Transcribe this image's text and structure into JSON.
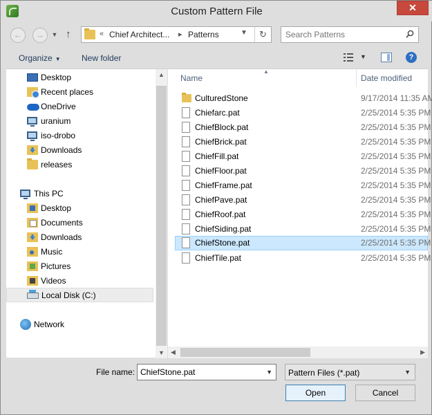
{
  "window": {
    "title": "Custom Pattern File"
  },
  "nav": {
    "address_segments": [
      "Chief Architect...",
      "Patterns"
    ],
    "search_placeholder": "Search Patterns"
  },
  "toolbar": {
    "organize_label": "Organize",
    "new_folder_label": "New folder"
  },
  "sidebar": {
    "items": [
      {
        "label": "Desktop",
        "icon": "desktop-icon"
      },
      {
        "label": "Recent places",
        "icon": "recent-places-icon"
      },
      {
        "label": "OneDrive",
        "icon": "onedrive-icon"
      },
      {
        "label": "uranium",
        "icon": "computer-icon"
      },
      {
        "label": "iso-drobo",
        "icon": "computer-icon"
      },
      {
        "label": "Downloads",
        "icon": "downloads-folder-icon"
      },
      {
        "label": "releases",
        "icon": "folder-icon"
      },
      {
        "label": "This PC",
        "icon": "this-pc-icon"
      },
      {
        "label": "Desktop",
        "icon": "desktop-folder-icon"
      },
      {
        "label": "Documents",
        "icon": "documents-folder-icon"
      },
      {
        "label": "Downloads",
        "icon": "downloads-folder-icon"
      },
      {
        "label": "Music",
        "icon": "music-folder-icon"
      },
      {
        "label": "Pictures",
        "icon": "pictures-folder-icon"
      },
      {
        "label": "Videos",
        "icon": "videos-folder-icon"
      },
      {
        "label": "Local Disk (C:)",
        "icon": "local-disk-icon"
      },
      {
        "label": "Network",
        "icon": "network-icon"
      }
    ]
  },
  "files": {
    "columns": [
      "Name",
      "Date modified"
    ],
    "rows": [
      {
        "name": "CulturedStone",
        "date": "9/17/2014 11:35 AM",
        "type": "folder"
      },
      {
        "name": "Chiefarc.pat",
        "date": "2/25/2014 5:35 PM",
        "type": "file"
      },
      {
        "name": "ChiefBlock.pat",
        "date": "2/25/2014 5:35 PM",
        "type": "file"
      },
      {
        "name": "ChiefBrick.pat",
        "date": "2/25/2014 5:35 PM",
        "type": "file"
      },
      {
        "name": "ChiefFill.pat",
        "date": "2/25/2014 5:35 PM",
        "type": "file"
      },
      {
        "name": "ChiefFloor.pat",
        "date": "2/25/2014 5:35 PM",
        "type": "file"
      },
      {
        "name": "ChiefFrame.pat",
        "date": "2/25/2014 5:35 PM",
        "type": "file"
      },
      {
        "name": "ChiefPave.pat",
        "date": "2/25/2014 5:35 PM",
        "type": "file"
      },
      {
        "name": "ChiefRoof.pat",
        "date": "2/25/2014 5:35 PM",
        "type": "file"
      },
      {
        "name": "ChiefSiding.pat",
        "date": "2/25/2014 5:35 PM",
        "type": "file"
      },
      {
        "name": "ChiefStone.pat",
        "date": "2/25/2014 5:35 PM",
        "type": "file",
        "selected": true
      },
      {
        "name": "ChiefTile.pat",
        "date": "2/25/2014 5:35 PM",
        "type": "file"
      }
    ]
  },
  "footer": {
    "file_name_label": "File name:",
    "file_name_value": "ChiefStone.pat",
    "file_type_value": "Pattern Files (*.pat)",
    "open_label": "Open",
    "cancel_label": "Cancel"
  }
}
